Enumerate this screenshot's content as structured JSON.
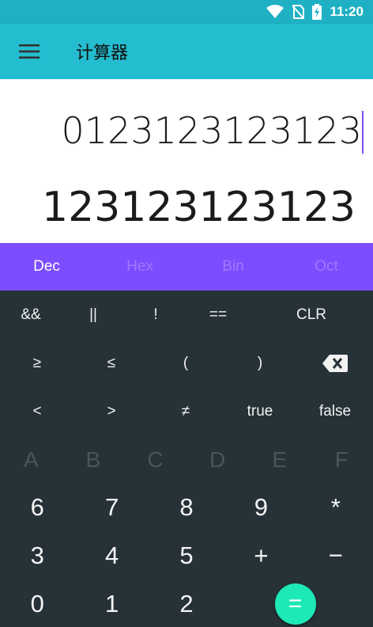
{
  "status": {
    "time": "11:20"
  },
  "appbar": {
    "title": "计算器"
  },
  "display": {
    "expression": "0123123123123",
    "result": "123123123123"
  },
  "bases": [
    {
      "label": "Dec",
      "active": true
    },
    {
      "label": "Hex",
      "active": false
    },
    {
      "label": "Bin",
      "active": false
    },
    {
      "label": "Oct",
      "active": false
    }
  ],
  "operators": {
    "row1": [
      "&&",
      "||",
      "!",
      "==",
      "CLR"
    ],
    "row2": [
      "≥",
      "≤",
      "(",
      ")"
    ],
    "row3": [
      "<",
      ">",
      "≠",
      "true",
      "false"
    ]
  },
  "hex_keys": [
    "A",
    "B",
    "C",
    "D",
    "E",
    "F"
  ],
  "keypad": {
    "row1": [
      "6",
      "7",
      "8",
      "9",
      "*"
    ],
    "row2": [
      "3",
      "4",
      "5",
      "+",
      "−"
    ],
    "row3": [
      "0",
      "1",
      "2"
    ],
    "equals": "="
  },
  "colors": {
    "statusbar": "#1fb0c4",
    "appbar": "#24bccf",
    "bases": "#7c4dff",
    "keypad": "#263238",
    "equals": "#1de9b6"
  },
  "icons": {
    "menu": "hamburger-menu-icon",
    "backspace": "backspace-icon",
    "wifi": "wifi-icon",
    "sim": "no-sim-icon",
    "battery": "battery-charging-icon"
  }
}
